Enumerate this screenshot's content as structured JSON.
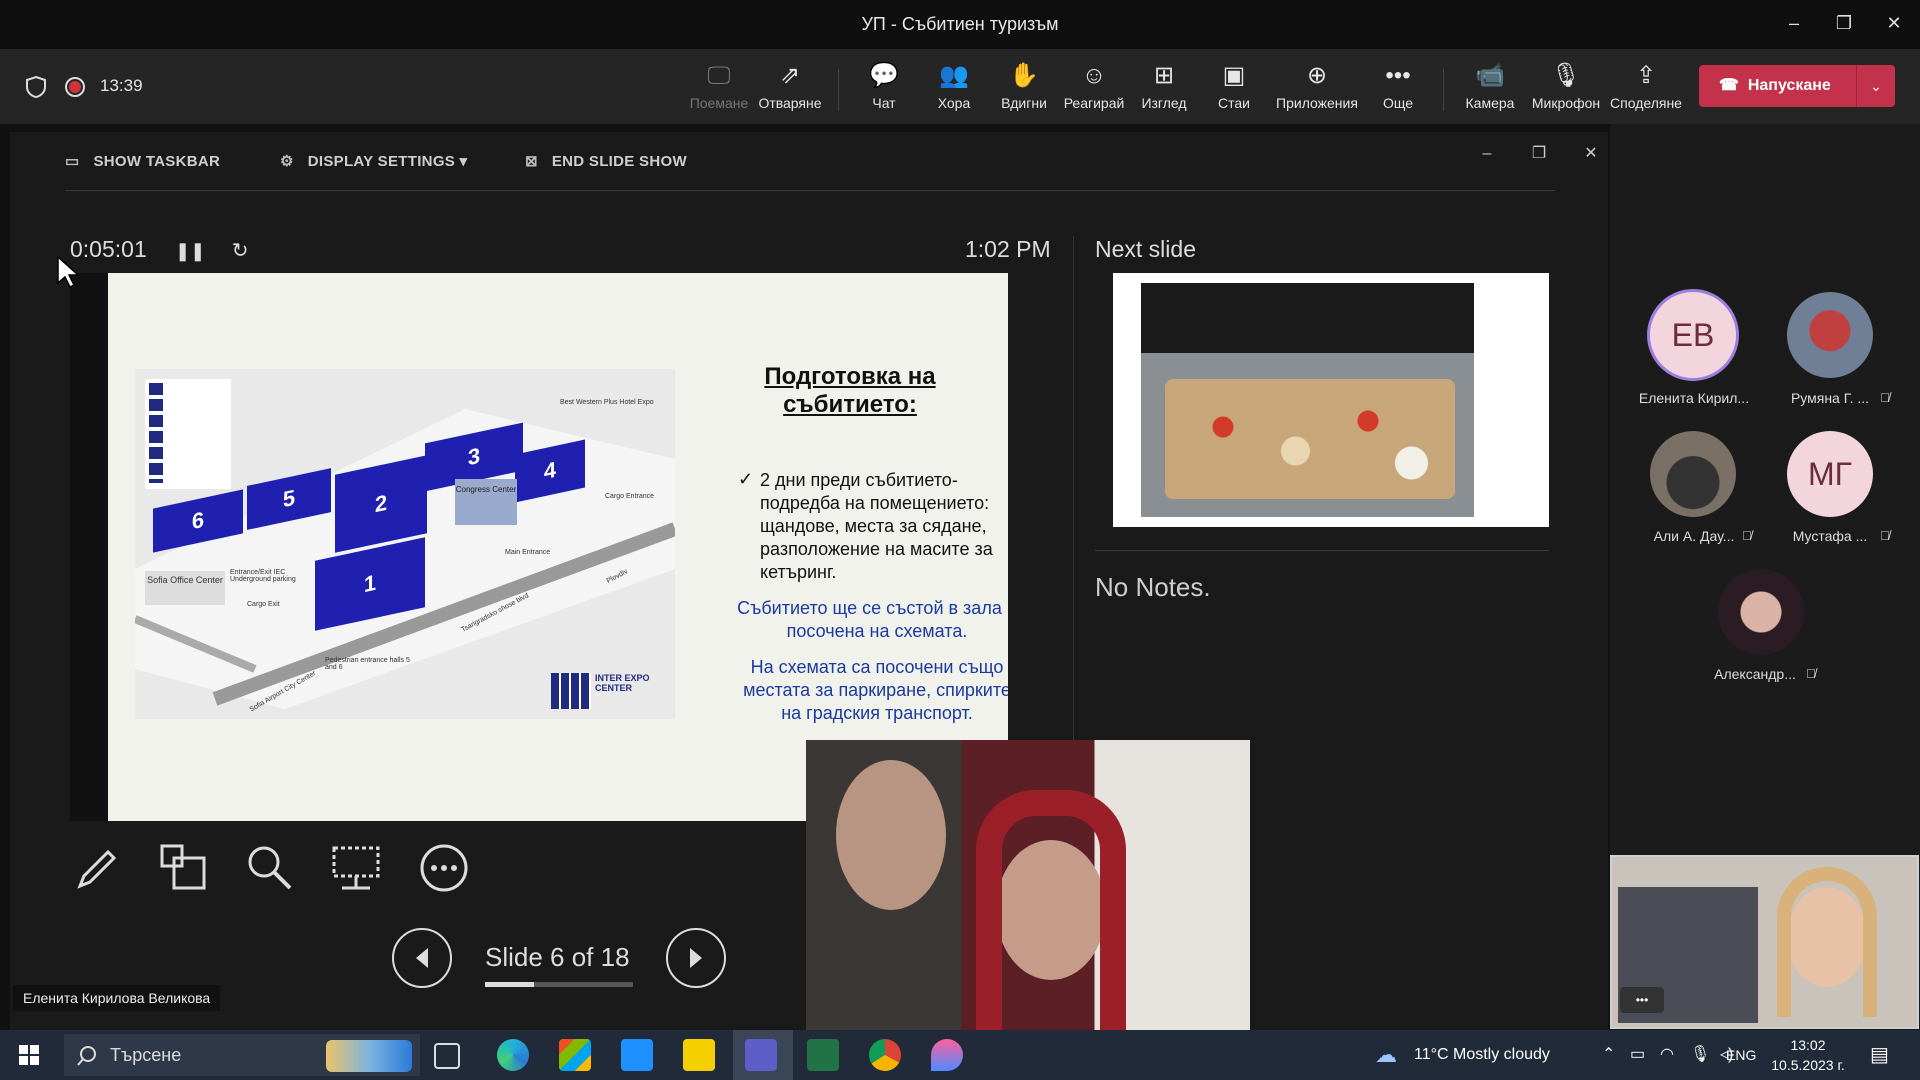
{
  "window": {
    "title": "УП - Събитиен туризъм",
    "minimize": "–",
    "restore": "❐",
    "close": "✕"
  },
  "toolbar": {
    "time": "13:39",
    "items": [
      {
        "label": "Поемане",
        "icon": "🖵"
      },
      {
        "label": "Отваряне",
        "icon": "⇗"
      },
      {
        "label": "Чат",
        "icon": "💬"
      },
      {
        "label": "Хора",
        "icon": "👥"
      },
      {
        "label": "Вдигни",
        "icon": "✋"
      },
      {
        "label": "Реагирай",
        "icon": "☺"
      },
      {
        "label": "Изглед",
        "icon": "⊞"
      },
      {
        "label": "Стаи",
        "icon": "▣"
      },
      {
        "label": "Приложения",
        "icon": "⊕"
      },
      {
        "label": "Още",
        "icon": "•••"
      },
      {
        "label": "Камера",
        "icon": "📹"
      },
      {
        "label": "Микрофон",
        "icon": "🎙"
      },
      {
        "label": "Споделяне",
        "icon": "⇪"
      }
    ],
    "leave_label": "Напускане",
    "leave_icon": "☎"
  },
  "presenter": {
    "show_taskbar": "SHOW TASKBAR",
    "display_settings": "DISPLAY SETTINGS ▾",
    "end_slide_show": "END SLIDE SHOW",
    "timer": "0:05:01",
    "clock": "1:02 PM",
    "next_slide_label": "Next slide",
    "notes": "No Notes.",
    "slide_counter": "Slide 6 of 18",
    "progress": 0.333,
    "slide": {
      "title_line1": "Подготовка на",
      "title_line2": "събитието:",
      "bullet": "2 дни преди събитието- подредба на помещението: щандове, места за сядане, разположение на масите за кетъринг.",
      "check": "✓",
      "blue1": "Събитието ще се състой в зала 1 посочена на схемата.",
      "blue2": "На схемата са посочени също местата за паркиране, спирките на градския транспорт.",
      "map": {
        "halls": [
          "6",
          "5",
          "2",
          "3",
          "4",
          "1"
        ],
        "labels": {
          "congress": "Congress Center",
          "sofia_office": "Sofia Office Center",
          "best_western": "Best Western Plus Hotel Expo",
          "cargo_entrance": "Cargo Entrance",
          "main_entrance": "Main Entrance",
          "cargo_exit": "Cargo Exit",
          "pedestrian": "Pedestrian entrance halls 5 and 6",
          "entrance_exit": "Entrance/Exit IEC Underground parking",
          "airport": "Sofia Airport City Center",
          "road": "Tsarigradsko shose blvd",
          "plovdiv": "Plovdiv",
          "iec": "INTER EXPO CENTER"
        }
      }
    }
  },
  "participants": [
    {
      "initials": "ЕВ",
      "name": "Еленита Кирил...",
      "muted": false
    },
    {
      "initials": "",
      "name": "Румяна Г. ...",
      "muted": true
    },
    {
      "initials": "",
      "name": "Али А. Дау...",
      "muted": true
    },
    {
      "initials": "МГ",
      "name": "Мустафа ...",
      "muted": true
    },
    {
      "initials": "",
      "name": "Александр...",
      "muted": true
    }
  ],
  "speaker_name": "Еленита Кирилова Великова",
  "selfview_more": "•••",
  "taskbar": {
    "search_placeholder": "Търсене",
    "weather": "11°C  Mostly cloudy",
    "lang": "ENG",
    "time": "13:02",
    "date": "10.5.2023 г."
  },
  "colors": {
    "leave": "#c4314b",
    "hall": "#1f1fb0",
    "accent_blue": "#1a3aa0"
  }
}
